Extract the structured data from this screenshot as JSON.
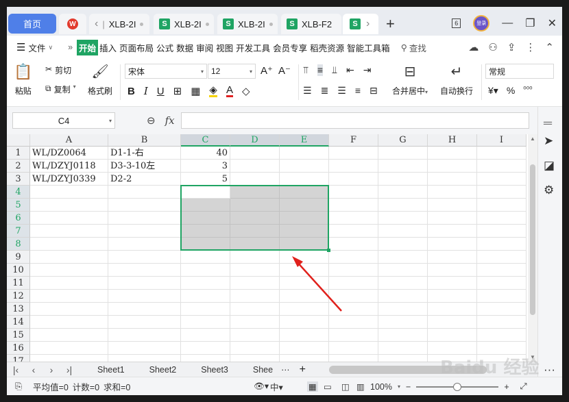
{
  "tabs": {
    "home": "首页",
    "docs": [
      "XLB-2I",
      "XLB-2I",
      "XLB-2I",
      "XLB-F2"
    ],
    "tab_count": "6"
  },
  "menu": {
    "file": "文件",
    "items": [
      "开始",
      "插入",
      "页面布局",
      "公式",
      "数据",
      "审阅",
      "视图",
      "开发工具",
      "会员专享",
      "稻壳资源",
      "智能工具箱"
    ],
    "search": "查找"
  },
  "ribbon": {
    "paste": "粘贴",
    "cut": "剪切",
    "copy": "复制",
    "format_painter": "格式刷",
    "font_name": "宋体",
    "font_size": "12",
    "merge_center": "合并居中",
    "wrap_text": "自动换行",
    "number_format": "常规"
  },
  "formula_bar": {
    "name_box": "C4",
    "fx": "fx",
    "formula": ""
  },
  "grid": {
    "columns": [
      "A",
      "B",
      "C",
      "D",
      "E",
      "F",
      "G",
      "H",
      "I"
    ],
    "rows": [
      "1",
      "2",
      "3",
      "4",
      "5",
      "6",
      "7",
      "8",
      "9",
      "10",
      "11",
      "12",
      "13",
      "14",
      "15",
      "16",
      "17"
    ],
    "selected_columns": [
      "C",
      "D",
      "E"
    ],
    "selected_rows": [
      "4",
      "5",
      "6",
      "7",
      "8"
    ],
    "selection_range": "C4:E8",
    "data": [
      {
        "A": "WL/DZ0064",
        "B": "D1-1-右",
        "C": "40"
      },
      {
        "A": "WL/DZYJ0118",
        "B": "D3-3-10左",
        "C": "3"
      },
      {
        "A": "WL/DZYJ0339",
        "B": "D2-2",
        "C": "5"
      }
    ]
  },
  "sheets": {
    "tabs": [
      "Sheet1",
      "Sheet2",
      "Sheet3",
      "Shee"
    ],
    "more": "···",
    "add": "+"
  },
  "status": {
    "average": "平均值=0",
    "count": "计数=0",
    "sum": "求和=0",
    "zoom": "100%",
    "lang": "中"
  },
  "colors": {
    "accent_green": "#1fa463",
    "home_tab_blue": "#4f7fe8",
    "selection_fill": "#d4d4d4",
    "annotation_arrow": "#e0211c"
  },
  "watermark": "Baidu 经验"
}
